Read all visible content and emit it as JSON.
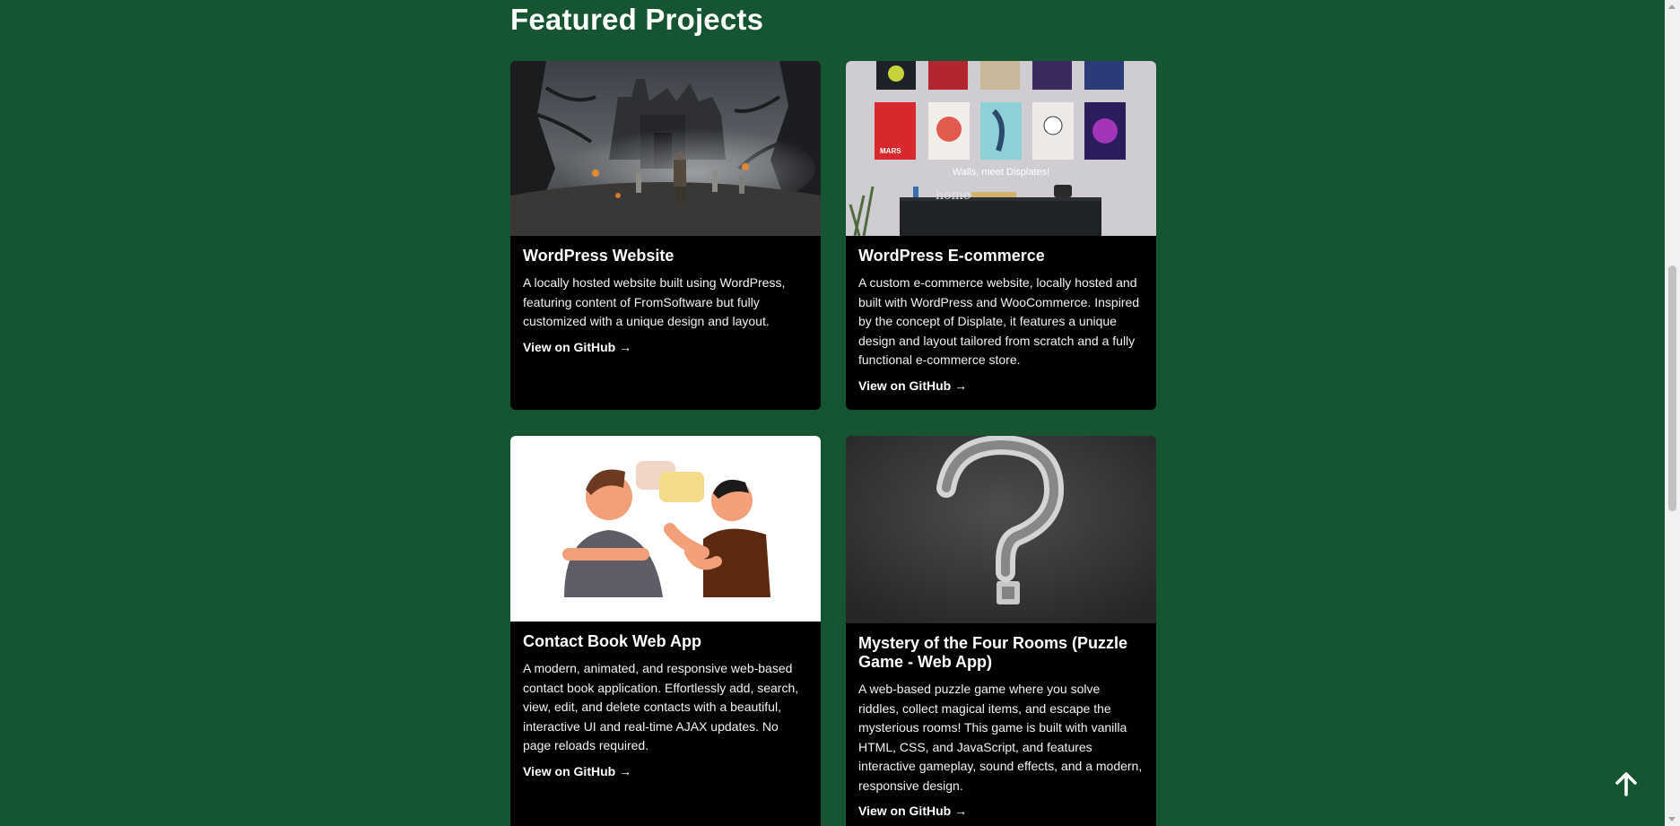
{
  "section": {
    "title": "Featured Projects"
  },
  "projects": [
    {
      "title": "WordPress Website",
      "description": "A locally hosted website built using WordPress, featuring content of FromSoftware but fully customized with a unique design and layout.",
      "link_label": "View on GitHub →"
    },
    {
      "title": "WordPress E-commerce",
      "description": "A custom e-commerce website, locally hosted and built with WordPress and WooCommerce. Inspired by the concept of Displate, it features a unique design and layout tailored from scratch and a fully functional e-commerce store.",
      "link_label": "View on GitHub →",
      "image_caption": "Walls, meet Displates!",
      "image_poster_text": "MARS",
      "image_sign_text": "home"
    },
    {
      "title": "Contact Book Web App",
      "description": "A modern, animated, and responsive web-based contact book application. Effortlessly add, search, view, edit, and delete contacts with a beautiful, interactive UI and real-time AJAX updates. No page reloads required.",
      "link_label": "View on GitHub →"
    },
    {
      "title": "Mystery of the Four Rooms (Puzzle Game - Web App)",
      "description": "A web-based puzzle game where you solve riddles, collect magical items, and escape the mysterious rooms! This game is built with vanilla HTML, CSS, and JavaScript, and features interactive gameplay, sound effects, and a modern, responsive design.",
      "link_label": "View on GitHub →"
    }
  ],
  "icons": {
    "back_to_top": "arrow-up-icon"
  },
  "colors": {
    "page_background": "#165531",
    "card_background": "#000000",
    "text": "#ffffff"
  }
}
